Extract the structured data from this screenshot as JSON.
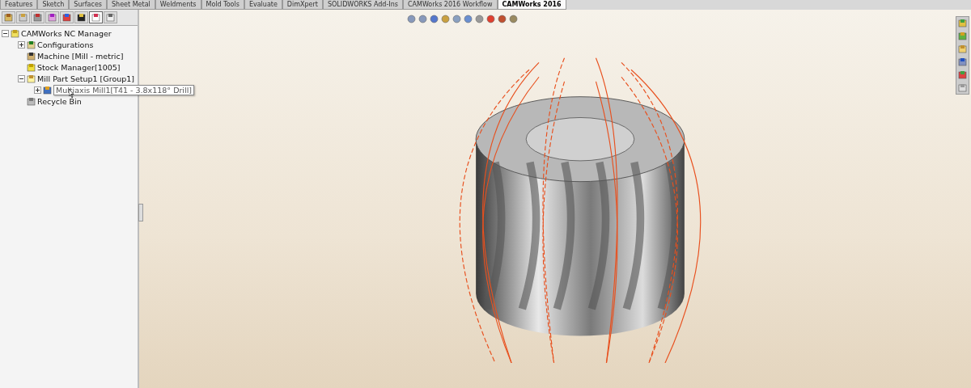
{
  "command_tabs": [
    {
      "label": "Features",
      "selected": false
    },
    {
      "label": "Sketch",
      "selected": false
    },
    {
      "label": "Surfaces",
      "selected": false
    },
    {
      "label": "Sheet Metal",
      "selected": false
    },
    {
      "label": "Weldments",
      "selected": false
    },
    {
      "label": "Mold Tools",
      "selected": false
    },
    {
      "label": "Evaluate",
      "selected": false
    },
    {
      "label": "DimXpert",
      "selected": false
    },
    {
      "label": "SOLIDWORKS Add-Ins",
      "selected": false
    },
    {
      "label": "CAMWorks 2016 Workflow",
      "selected": false
    },
    {
      "label": "CAMWorks 2016",
      "selected": true
    }
  ],
  "manager_tabs": [
    {
      "selected": false
    },
    {
      "selected": false
    },
    {
      "selected": false
    },
    {
      "selected": false
    },
    {
      "selected": false
    },
    {
      "selected": false
    },
    {
      "selected": true
    },
    {
      "selected": false
    }
  ],
  "tree": [
    {
      "label": "CAMWorks NC Manager",
      "kind": "root",
      "expanded": true,
      "children": [
        {
          "label": "Configurations",
          "kind": "config",
          "expanded": false,
          "hovered": false
        },
        {
          "label": "Machine [Mill - metric]",
          "kind": "machine",
          "hovered": false
        },
        {
          "label": "Stock Manager[1005]",
          "kind": "stock",
          "hovered": false
        },
        {
          "label": "Mill Part Setup1 [Group1]",
          "kind": "setup",
          "expanded": true,
          "hovered": false,
          "children": [
            {
              "label": "Multiaxis Mill1[T41 - 3.8x118° Drill]",
              "kind": "operation",
              "expanded": false,
              "hovered": true
            }
          ]
        },
        {
          "label": "Recycle Bin",
          "kind": "bin",
          "hovered": false
        }
      ]
    }
  ]
}
